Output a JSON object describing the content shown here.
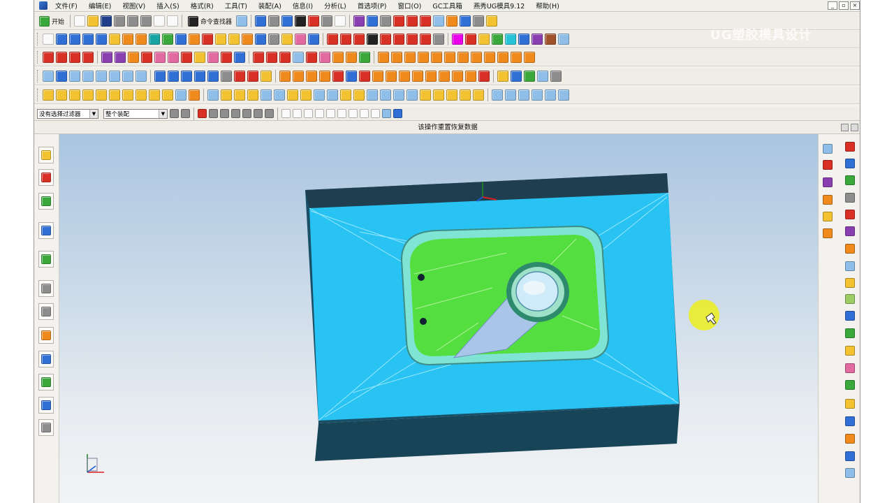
{
  "menubar": {
    "items": [
      "文件(F)",
      "编辑(E)",
      "视图(V)",
      "插入(S)",
      "格式(R)",
      "工具(T)",
      "装配(A)",
      "信息(I)",
      "分析(L)",
      "首选项(P)",
      "窗口(O)",
      "GC工具箱",
      "燕秀UG模具9.12",
      "帮助(H)"
    ],
    "window_controls": [
      "_",
      "▫",
      "×"
    ]
  },
  "toolbar": {
    "start_label": "开始",
    "command_finder_label": "命令查找器"
  },
  "selection_bar": {
    "filter_value": "没有选择过滤器",
    "scope_value": "整个装配"
  },
  "status": {
    "message": "该操作重置恢复数据"
  },
  "watermark": {
    "text": "UG塑胶模具设计"
  },
  "colors": {
    "mold_base": "#28c3f2",
    "mold_side": "#194e63",
    "insert_green": "#55de3f",
    "cursor_highlight": "#f0f000"
  }
}
